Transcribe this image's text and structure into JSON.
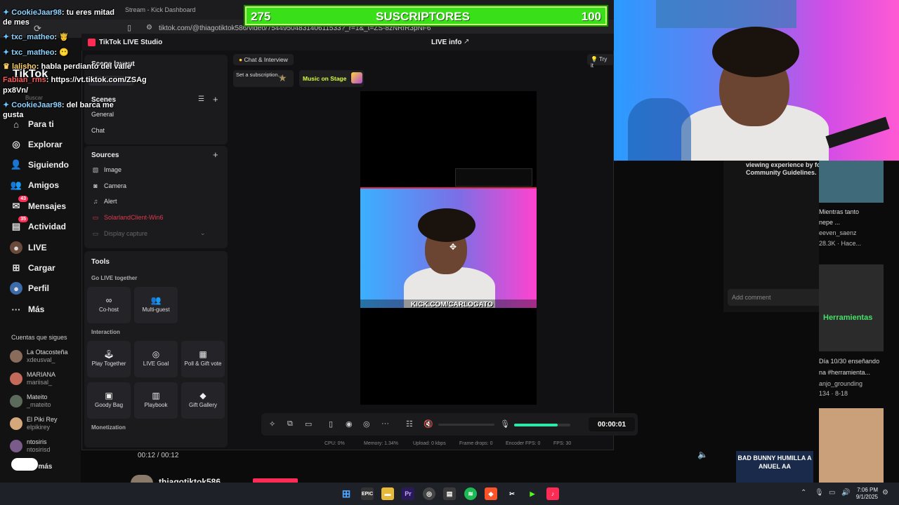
{
  "browser": {
    "tab_title": "Stream - Kick Dashboard",
    "url": "tiktok.com/@thiagotiktok586/video/7544950483140611533?_r=1&_t=ZS-8zNRfR3pNF6"
  },
  "overlay": {
    "subs_count": "275",
    "subs_label": "SUSCRIPTORES",
    "subs_goal": "100",
    "chat": [
      {
        "user": "CookieJaar98",
        "sep": ": ",
        "text": "tu eres mitad"
      },
      {
        "user": "",
        "sep": "",
        "text": "de mes"
      },
      {
        "user": "txc_matheo",
        "sep": ": ",
        "text": ""
      },
      {
        "user": "txc_matheo",
        "sep": ": ",
        "text": ""
      },
      {
        "user": "lalisho",
        "sep": ": ",
        "text": "habla perdianto del valle"
      },
      {
        "user": "Fabian_rms",
        "sep": ": ",
        "text": "https://vt.tiktok.com/ZSAg"
      },
      {
        "user": "",
        "sep": "",
        "text": "px8Vn/"
      },
      {
        "user": "CookieJaar98",
        "sep": ": ",
        "text": "del barca me"
      },
      {
        "user": "",
        "sep": "",
        "text": "gusta"
      }
    ],
    "cam_banner": "KICK.COM/CARLOGATO"
  },
  "tiktok_web": {
    "logo": "TikTok",
    "search_placeholder": "Buscar",
    "nav": [
      {
        "label": "Para ti",
        "icon": "home-icon"
      },
      {
        "label": "Explorar",
        "icon": "compass-icon"
      },
      {
        "label": "Siguiendo",
        "icon": "following-icon"
      },
      {
        "label": "Amigos",
        "icon": "friends-icon"
      },
      {
        "label": "Mensajes",
        "icon": "messages-icon",
        "badge": "43"
      },
      {
        "label": "Actividad",
        "icon": "activity-icon",
        "badge": "35"
      },
      {
        "label": "LIVE",
        "icon": "live-icon"
      },
      {
        "label": "Cargar",
        "icon": "upload-icon"
      },
      {
        "label": "Perfil",
        "icon": "profile-icon"
      },
      {
        "label": "Más",
        "icon": "more-icon"
      }
    ],
    "following_title": "Cuentas que sigues",
    "following": [
      {
        "name": "La Otacosteña",
        "handle": "xdeusval_"
      },
      {
        "name": "MARIANA",
        "handle": "mariisal_"
      },
      {
        "name": "Mateito",
        "handle": "_mateito"
      },
      {
        "name": "El Piki Rey",
        "handle": "elpikirey"
      },
      {
        "name": "ntosiris",
        "handle": "ntosirisd"
      }
    ],
    "see_more": "Ver más",
    "video_time": "00:12 / 00:12",
    "video_author": "thiagotiktok586",
    "comment_placeholder": "Add comment",
    "guidelines_text_1": "viewing experience by following our",
    "guidelines_text_2": "Community Guidelines.",
    "rec": [
      {
        "l1": "Mientras tanto",
        "l2": "nepe ...",
        "l3": "eeven_saenz",
        "l4": "28.3K · Hace..."
      },
      {
        "l1": "Día 10/30 enseñando",
        "l2": "na #herramienta...",
        "l3": "anjo_grounding",
        "l4": "134 · 8-18"
      }
    ],
    "thumb_text": "Herramientas",
    "thumb_text_2": "BAD BUNNY HUMILLA A ANUEL AA"
  },
  "studio": {
    "app_title": "TikTok LIVE Studio",
    "live_info": "LIVE info",
    "scene_layout": "Scene layout",
    "scenes_title": "Scenes",
    "scenes": [
      "General",
      "Chat"
    ],
    "sources_title": "Sources",
    "sources": [
      {
        "label": "Image",
        "icon": "image-icon"
      },
      {
        "label": "Camera",
        "icon": "camera-icon"
      },
      {
        "label": "Alert",
        "icon": "bell-icon"
      },
      {
        "label": "SolarlandClient-Win6",
        "icon": "window-icon"
      },
      {
        "label": "Display capture",
        "icon": "monitor-icon"
      }
    ],
    "tools_title": "Tools",
    "go_live_together": "Go LIVE together",
    "cohost": "Co-host",
    "multiguest": "Multi-guest",
    "interaction": "Interaction",
    "play_together": "Play Together",
    "live_goal": "LIVE Goal",
    "poll_gift": "Poll & Gift vote",
    "goody_bag": "Goody Bag",
    "playbook": "Playbook",
    "gift_gallery": "Gift Gallery",
    "monetization": "Monetization",
    "chat_interview": "Chat & Interview",
    "set_subscription": "Set a subscription...",
    "music_on_stage": "Music on Stage",
    "try_it": "Try it",
    "timer": "00:00:01",
    "volume_level": 0.78,
    "stats": {
      "cpu": "CPU: 0%",
      "memory": "Memory: 1.34%",
      "upload": "Upload: 0 kbps",
      "frame_drops": "Frame drops: 0",
      "encoder_fps": "Encoder FPS: 0",
      "fps": "FPS: 30"
    }
  },
  "taskbar": {
    "time": "7:06 PM",
    "date": "9/1/2025"
  }
}
